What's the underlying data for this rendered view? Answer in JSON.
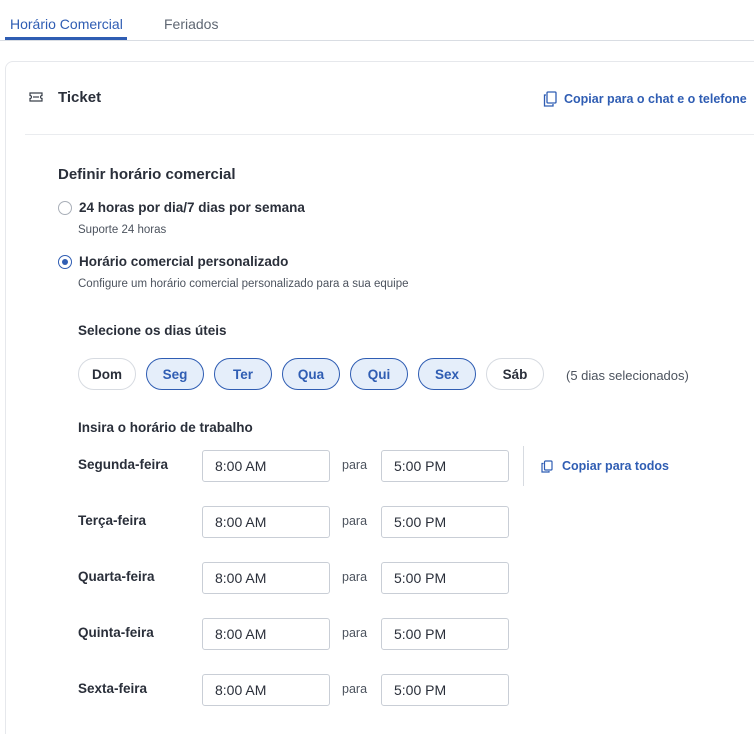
{
  "tabs": [
    {
      "label": "Horário Comercial",
      "active": true
    },
    {
      "label": "Feriados",
      "active": false
    }
  ],
  "ticket": {
    "icon": "ticket-icon",
    "title": "Ticket",
    "copy_link": "Copiar para o chat e o telefone"
  },
  "business_hours": {
    "title": "Definir horário comercial",
    "options": [
      {
        "label": "24 horas por dia/7 dias por semana",
        "description": "Suporte 24 horas",
        "checked": false
      },
      {
        "label": "Horário comercial personalizado",
        "description": "Configure um horário comercial personalizado para a sua equipe",
        "checked": true
      }
    ]
  },
  "workdays": {
    "title": "Selecione os dias úteis",
    "days": [
      {
        "label": "Dom",
        "selected": false
      },
      {
        "label": "Seg",
        "selected": true
      },
      {
        "label": "Ter",
        "selected": true
      },
      {
        "label": "Qua",
        "selected": true
      },
      {
        "label": "Qui",
        "selected": true
      },
      {
        "label": "Sex",
        "selected": true
      },
      {
        "label": "Sáb",
        "selected": false
      }
    ],
    "count_label": "(5 dias selecionados)"
  },
  "hours": {
    "title": "Insira o horário de trabalho",
    "separator": "para",
    "copy_all": "Copiar para todos",
    "rows": [
      {
        "day": "Segunda-feira",
        "start": "8:00 AM",
        "end": "5:00 PM"
      },
      {
        "day": "Terça-feira",
        "start": "8:00 AM",
        "end": "5:00 PM"
      },
      {
        "day": "Quarta-feira",
        "start": "8:00 AM",
        "end": "5:00 PM"
      },
      {
        "day": "Quinta-feira",
        "start": "8:00 AM",
        "end": "5:00 PM"
      },
      {
        "day": "Sexta-feira",
        "start": "8:00 AM",
        "end": "5:00 PM"
      }
    ]
  },
  "colors": {
    "accent": "#2f5db3",
    "selected_bg": "#e5eefa",
    "text": "#2a2f3a"
  }
}
